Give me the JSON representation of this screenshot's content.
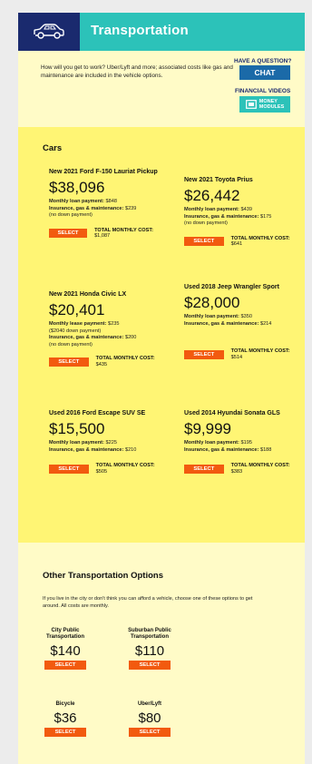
{
  "header": {
    "title": "Transportation",
    "logo_icon": "car-icon"
  },
  "intro_text": "How will you get to work? Uber/Lyft and more; associated costs like gas and maintenance are included in the vehicle options.",
  "help": {
    "question_label": "HAVE A QUESTION?",
    "chat_label": "CHAT",
    "videos_label": "FINANCIAL VIDEOS",
    "money_modules_line1": "MONEY",
    "money_modules_line2": "MODULES"
  },
  "cars": {
    "section_title": "Cars",
    "select_label": "SELECT",
    "items": [
      {
        "name": "New 2021 Ford F-150 Lauriat Pickup",
        "price": "$38,096",
        "line1_label": "Monthly loan payment:",
        "line1_value": "$848",
        "line2_label": "Insurance, gas & maintenance:",
        "line2_value": "$239",
        "line3": "(no down payment)",
        "total_label": "TOTAL MONTHLY COST:",
        "total_value": "$1,087"
      },
      {
        "name": "New 2021 Toyota Prius",
        "price": "$26,442",
        "line1_label": "Monthly loan payment:",
        "line1_value": "$439",
        "line2_label": "Insurance, gas & maintenance:",
        "line2_value": "$175",
        "line3": "(no down payment)",
        "total_label": "TOTAL MONTHLY COST:",
        "total_value": "$641"
      },
      {
        "name": "New 2021 Honda Civic LX",
        "price": "$20,401",
        "line1_label": "Monthly lease payment:",
        "line1_value": "$235",
        "line1b": "($2040 down payment)",
        "line2_label": "Insurance, gas & maintenance:",
        "line2_value": "$200",
        "line3": "(no down payment)",
        "total_label": "TOTAL MONTHLY COST:",
        "total_value": "$435"
      },
      {
        "name": "Used 2018 Jeep Wrangler Sport",
        "price": "$28,000",
        "line1_label": "Monthly loan payment:",
        "line1_value": "$350",
        "line2_label": "Insurance, gas & maintenance:",
        "line2_value": "$214",
        "total_label": "TOTAL MONTHLY COST:",
        "total_value": "$514"
      },
      {
        "name": "Used 2016 Ford Escape SUV SE",
        "price": "$15,500",
        "line1_label": "Monthly loan payment:",
        "line1_value": "$225",
        "line2_label": "Insurance, gas & maintenance:",
        "line2_value": "$210",
        "total_label": "TOTAL MONTHLY COST:",
        "total_value": "$505"
      },
      {
        "name": "Used 2014 Hyundai Sonata GLS",
        "price": "$9,999",
        "line1_label": "Monthly loan payment:",
        "line1_value": "$195",
        "line2_label": "Insurance, gas & maintenance:",
        "line2_value": "$188",
        "total_label": "TOTAL MONTHLY COST:",
        "total_value": "$383"
      }
    ]
  },
  "other": {
    "section_title": "Other Transportation Options",
    "intro": "If you live in the city or don't think you can afford a vehicle, choose one of these options to get around. All costs are monthly.",
    "select_label": "SELECT",
    "items": [
      {
        "name": "City Public Transportation",
        "price": "$140"
      },
      {
        "name": "Suburban Public Transportation",
        "price": "$110"
      },
      {
        "name": "Bicycle",
        "price": "$36"
      },
      {
        "name": "Uber/Lyft",
        "price": "$80"
      }
    ]
  },
  "colors": {
    "header_teal": "#2cc2b9",
    "logo_navy": "#1a2a6e",
    "page_cream": "#fffbc7",
    "cars_yellow": "#fff574",
    "select_orange": "#f25a0f",
    "chat_blue": "#1b6aa8"
  }
}
